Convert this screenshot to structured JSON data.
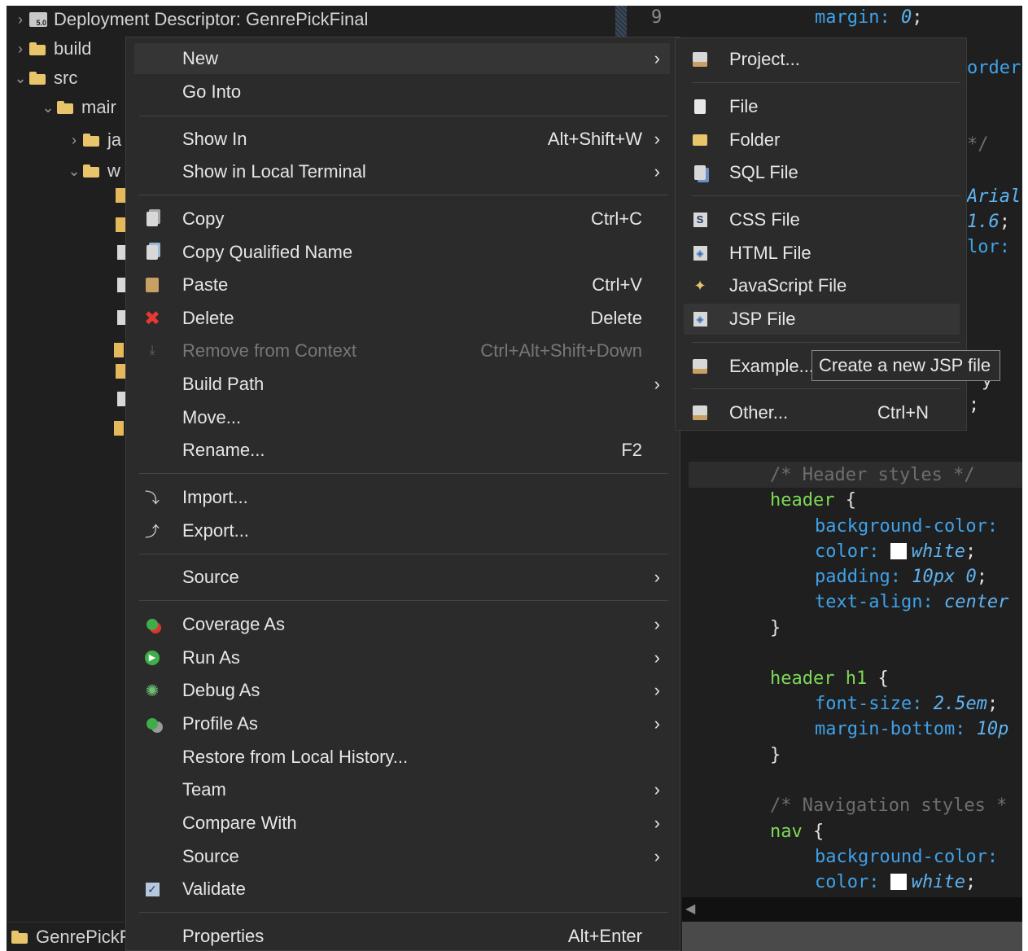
{
  "explorer": {
    "items": [
      {
        "label": "Deployment Descriptor: GenrePickFinal",
        "chevron": "›"
      },
      {
        "label": "build",
        "chevron": "›"
      },
      {
        "label": "src",
        "chevron": "⌄"
      },
      {
        "label": "mair",
        "chevron": "⌄"
      },
      {
        "label": "ja",
        "chevron": "›"
      },
      {
        "label": "w",
        "chevron": "⌄"
      }
    ],
    "status_label": "GenrePickF"
  },
  "editor": {
    "line_number": "9",
    "lines": {
      "l1_prop": "margin: ",
      "l1_val": "0",
      "l1_end": ";",
      "l2": "order",
      "l3": "*/",
      "l4": "Arial",
      "l5_val": "1.6",
      "l5_end": ";",
      "l6": "lor:",
      "l7": "y",
      "l8": ";",
      "l9": ";",
      "comment_header": "/* Header styles */",
      "sel_header": "header",
      "brace_open": " {",
      "bg1": "background-color:",
      "color_prop": "color: ",
      "white1": "white",
      "semi": ";",
      "padding_prop": "padding: ",
      "padding_val": "10px 0",
      "textalign_prop": "text-align: ",
      "textalign_val": "center",
      "brace_close": "}",
      "sel_h1": "header h1",
      "fontsize_prop": "font-size: ",
      "fontsize_val": "2.5em",
      "marginb_prop": "margin-bottom: ",
      "marginb_val": "10p",
      "comment_nav": "/* Navigation styles *",
      "sel_nav": "nav",
      "bg2": "background-color:",
      "white2": "white"
    }
  },
  "context_menu": {
    "items": [
      {
        "label": "New",
        "shortcut": "",
        "submenu": "›"
      },
      {
        "label": "Go Into",
        "shortcut": ""
      },
      {
        "label": "Show In",
        "shortcut": "Alt+Shift+W",
        "submenu": "›"
      },
      {
        "label": "Show in Local Terminal",
        "shortcut": "",
        "submenu": "›"
      },
      {
        "label": "Copy",
        "shortcut": "Ctrl+C"
      },
      {
        "label": "Copy Qualified Name",
        "shortcut": ""
      },
      {
        "label": "Paste",
        "shortcut": "Ctrl+V"
      },
      {
        "label": "Delete",
        "shortcut": "Delete"
      },
      {
        "label": "Remove from Context",
        "shortcut": "Ctrl+Alt+Shift+Down"
      },
      {
        "label": "Build Path",
        "shortcut": "",
        "submenu": "›"
      },
      {
        "label": "Move...",
        "shortcut": ""
      },
      {
        "label": "Rename...",
        "shortcut": "F2"
      },
      {
        "label": "Import...",
        "shortcut": ""
      },
      {
        "label": "Export...",
        "shortcut": ""
      },
      {
        "label": "Source",
        "shortcut": "",
        "submenu": "›"
      },
      {
        "label": "Coverage As",
        "shortcut": "",
        "submenu": "›"
      },
      {
        "label": "Run As",
        "shortcut": "",
        "submenu": "›"
      },
      {
        "label": "Debug As",
        "shortcut": "",
        "submenu": "›"
      },
      {
        "label": "Profile As",
        "shortcut": "",
        "submenu": "›"
      },
      {
        "label": "Restore from Local History...",
        "shortcut": ""
      },
      {
        "label": "Team",
        "shortcut": "",
        "submenu": "›"
      },
      {
        "label": "Compare With",
        "shortcut": "",
        "submenu": "›"
      },
      {
        "label": "Source",
        "shortcut": "",
        "submenu": "›"
      },
      {
        "label": "Validate",
        "shortcut": ""
      },
      {
        "label": "Properties",
        "shortcut": "Alt+Enter"
      }
    ]
  },
  "new_submenu": {
    "items": [
      {
        "label": "Project...",
        "shortcut": ""
      },
      {
        "label": "File",
        "shortcut": ""
      },
      {
        "label": "Folder",
        "shortcut": ""
      },
      {
        "label": "SQL File",
        "shortcut": ""
      },
      {
        "label": "CSS File",
        "shortcut": ""
      },
      {
        "label": "HTML File",
        "shortcut": ""
      },
      {
        "label": "JavaScript File",
        "shortcut": ""
      },
      {
        "label": "JSP File",
        "shortcut": ""
      },
      {
        "label": "Example...",
        "shortcut": ""
      },
      {
        "label": "Other...",
        "shortcut": "Ctrl+N"
      }
    ]
  },
  "tooltip": {
    "text": "Create a new JSP file"
  },
  "colors": {
    "background": "#1f1f1f",
    "menu": "#2b2b2b",
    "hover": "#353535",
    "property": "#3fa2e8",
    "selector": "#7ed957",
    "delete_red": "#e53935"
  }
}
